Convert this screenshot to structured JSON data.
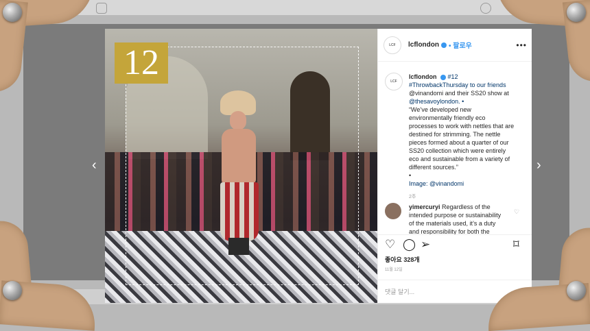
{
  "post": {
    "username": "lcflondon",
    "follow_label": "팔로우",
    "more_label": "•••",
    "photo_badge": "12",
    "avatar_text": "LCF",
    "caption_user": "lcflondon",
    "caption_lines": [
      "#12",
      "#ThrowbackThursday to our friends",
      "@vinandomi and their SS20 show at",
      "@thesavoylondon. •",
      "“We’ve developed new",
      "environmentally friendly eco",
      "processes to work with nettles that are",
      "destined for strimming. The nettle",
      "pieces formed about a quarter of our",
      "SS20 collection which were entirely",
      "eco and sustainable from a variety of",
      "different sources.”",
      "•",
      "Image: @vinandomi"
    ],
    "caption_time": "2주",
    "comment_user": "yimercuryi",
    "comment_lines": [
      "Regardless of the",
      "intended purpose or sustainability",
      "of the materials used, it’s a duty",
      "and responsibility for both the"
    ],
    "likes": "좋아요 328개",
    "date": "11월 12일",
    "add_comment_placeholder": "댓글 달기..."
  },
  "icons": {
    "like": "heart-icon",
    "comment": "comment-icon",
    "share": "share-icon",
    "save": "bookmark-icon",
    "prev": "chevron-left-icon",
    "next": "chevron-right-icon"
  },
  "colors": {
    "link": "#003569",
    "accent": "#3897f0",
    "badge": "#c4a53a"
  }
}
